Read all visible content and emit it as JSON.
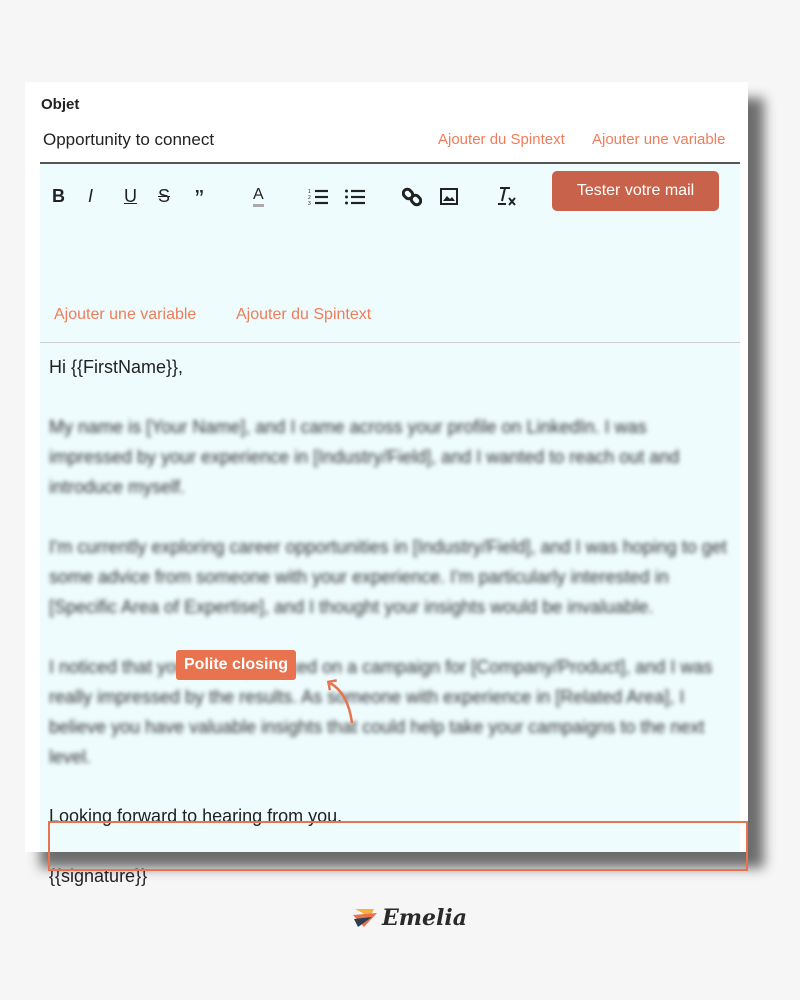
{
  "subject": {
    "label": "Objet",
    "value": "Opportunity to connect",
    "add_spintext": "Ajouter du Spintext",
    "add_variable": "Ajouter une variable"
  },
  "toolbar": {
    "bold": "B",
    "italic": "I",
    "underline": "U",
    "strike": "S",
    "quote": "”",
    "color": "A",
    "test_button": "Tester votre mail",
    "add_variable": "Ajouter une variable",
    "add_spintext": "Ajouter du Spintext"
  },
  "body": {
    "greeting": "Hi {{FirstName}},",
    "p1": "My name is [Your Name], and I came across your profile on LinkedIn. I was impressed by your experience in [Industry/Field], and I wanted to reach out and introduce myself.",
    "p2": "I'm currently exploring career opportunities in [Industry/Field], and I was hoping to get some advice from someone with your experience. I'm particularly interested in [Specific Area of Expertise], and I thought your insights would be invaluable.",
    "p3": "I noticed that you recently worked on a campaign for [Company/Product], and I was really impressed by the results. As someone with experience in [Related Area], I believe you have valuable insights that could help take your campaigns to the next level.",
    "closing": "Looking forward to hearing from you.",
    "signature": "{{signature}}"
  },
  "annotation": {
    "label": "Polite closing",
    "color": "#e8734e"
  },
  "brand": {
    "logo_text": "Emelia"
  }
}
